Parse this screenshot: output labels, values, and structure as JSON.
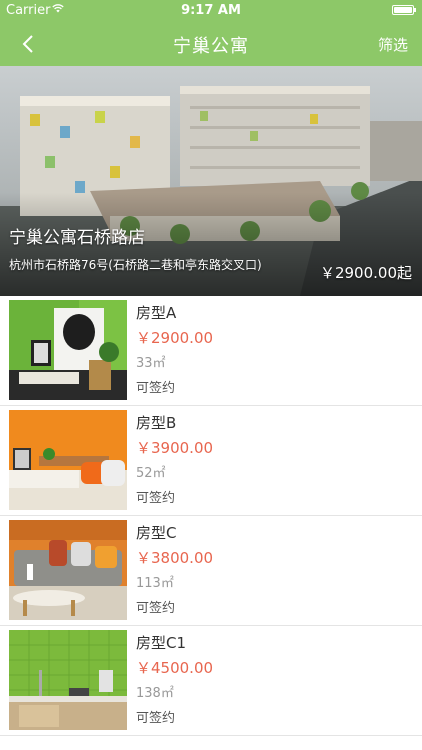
{
  "status_bar": {
    "carrier": "Carrier",
    "time": "9:17 AM"
  },
  "nav": {
    "title": "宁巢公寓",
    "filter_label": "筛选",
    "back_icon": "chevron-left-icon"
  },
  "hero": {
    "name": "宁巢公寓石桥路店",
    "address": "杭州市石桥路76号(石桥路二巷和亭东路交叉口)",
    "price": "￥2900.00起"
  },
  "rooms": [
    {
      "name": "房型A",
      "price": "￥2900.00",
      "area": "33㎡",
      "status": "可签约"
    },
    {
      "name": "房型B",
      "price": "￥3900.00",
      "area": "52㎡",
      "status": "可签约"
    },
    {
      "name": "房型C",
      "price": "￥3800.00",
      "area": "113㎡",
      "status": "可签约"
    },
    {
      "name": "房型C1",
      "price": "￥4500.00",
      "area": "138㎡",
      "status": "可签约"
    }
  ],
  "colors": {
    "brand_green": "#8dc868",
    "price_red": "#e8664f"
  }
}
